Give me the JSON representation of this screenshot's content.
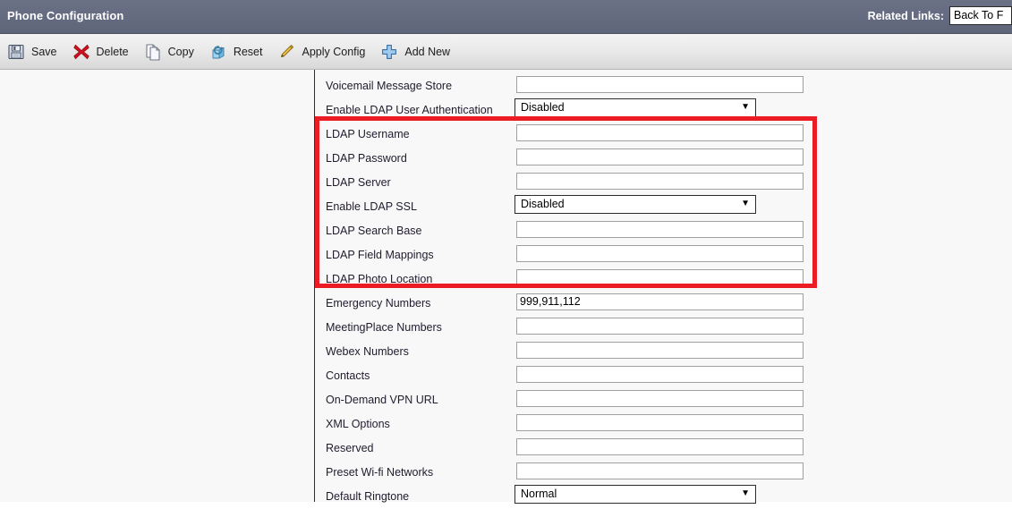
{
  "titlebar": {
    "title": "Phone Configuration",
    "related_links_label": "Related Links:",
    "related_links_value": "Back To F"
  },
  "toolbar": {
    "buttons": [
      {
        "label": "Save",
        "icon": "save-floppy-icon"
      },
      {
        "label": "Delete",
        "icon": "delete-x-icon"
      },
      {
        "label": "Copy",
        "icon": "copy-pages-icon"
      },
      {
        "label": "Reset",
        "icon": "reset-cube-icon"
      },
      {
        "label": "Apply Config",
        "icon": "pencil-icon"
      },
      {
        "label": "Add New",
        "icon": "plus-icon"
      }
    ]
  },
  "highlight": {
    "color": "#ec1c24",
    "note": "red rectangle around LDAP fields"
  },
  "form": {
    "rows": [
      {
        "label": "Voicemail Message Store",
        "type": "text",
        "value": ""
      },
      {
        "label": "Enable LDAP User Authentication",
        "type": "select",
        "value": "Disabled"
      },
      {
        "label": "LDAP Username",
        "type": "text",
        "value": ""
      },
      {
        "label": "LDAP Password",
        "type": "text",
        "value": ""
      },
      {
        "label": "LDAP Server",
        "type": "text",
        "value": ""
      },
      {
        "label": "Enable LDAP SSL",
        "type": "select",
        "value": "Disabled"
      },
      {
        "label": "LDAP Search Base",
        "type": "text",
        "value": ""
      },
      {
        "label": "LDAP Field Mappings",
        "type": "text",
        "value": ""
      },
      {
        "label": "LDAP Photo Location",
        "type": "text",
        "value": ""
      },
      {
        "label": "Emergency Numbers",
        "type": "text",
        "value": "999,911,112"
      },
      {
        "label": "MeetingPlace Numbers",
        "type": "text",
        "value": ""
      },
      {
        "label": "Webex Numbers",
        "type": "text",
        "value": ""
      },
      {
        "label": "Contacts",
        "type": "text",
        "value": ""
      },
      {
        "label": "On-Demand VPN URL",
        "type": "text",
        "value": ""
      },
      {
        "label": "XML Options",
        "type": "text",
        "value": ""
      },
      {
        "label": "Reserved",
        "type": "text",
        "value": ""
      },
      {
        "label": "Preset Wi-fi Networks",
        "type": "text",
        "value": ""
      },
      {
        "label": "Default Ringtone",
        "type": "select",
        "value": "Normal"
      }
    ]
  },
  "colors": {
    "titlebar_bg": "#656b80",
    "highlight_red": "#ec1c24",
    "content_bg": "#f8f8f8"
  }
}
